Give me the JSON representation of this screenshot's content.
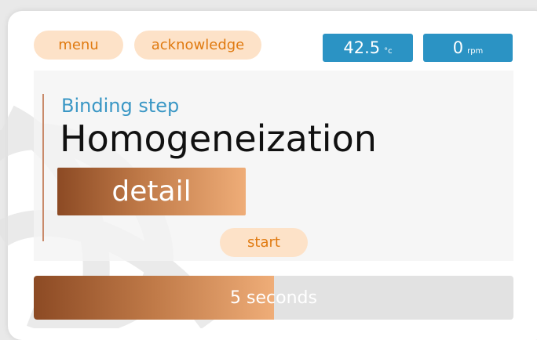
{
  "header": {
    "menu_label": "menu",
    "acknowledge_label": "acknowledge"
  },
  "readouts": {
    "temperature": {
      "value": "42.5",
      "unit": "°c"
    },
    "speed": {
      "value": "0",
      "unit": "rpm"
    }
  },
  "step": {
    "label": "Binding step",
    "name": "Homogeneization",
    "detail_label": "detail",
    "start_label": "start"
  },
  "progress": {
    "text": "5 seconds",
    "fraction": 0.5
  },
  "colors": {
    "accent_blue": "#2b93c4",
    "pill_bg": "#fde2c8",
    "pill_text": "#e07a10",
    "brown_dark": "#8c4a24",
    "brown_light": "#efad78"
  }
}
